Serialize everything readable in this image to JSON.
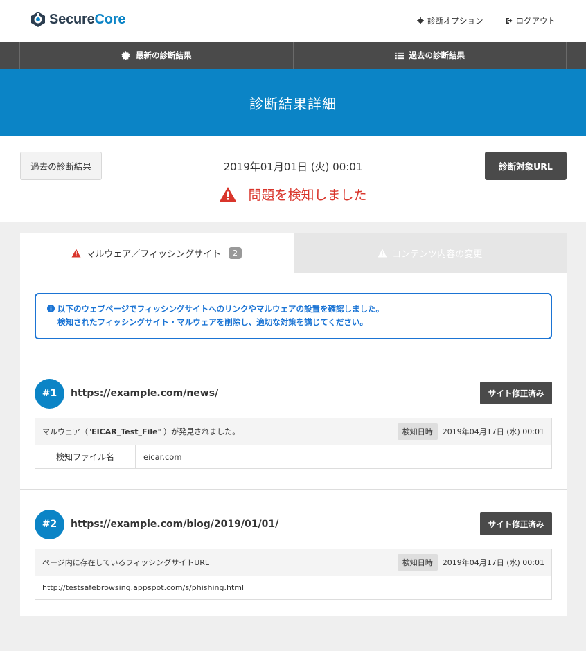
{
  "brand": {
    "name_part1": "Secure",
    "name_part2": "Core"
  },
  "top_links": {
    "options": "診断オプション",
    "logout": "ログアウト"
  },
  "nav": {
    "latest": "最新の診断結果",
    "history": "過去の診断結果"
  },
  "banner": {
    "title": "診断結果詳細"
  },
  "summary": {
    "past_button": "過去の診断結果",
    "date": "2019年01月01日 (火) 00:01",
    "alert": "問題を検知しました",
    "url_button": "診断対象URL"
  },
  "tabs": [
    {
      "label": "マルウェア／フィッシングサイト",
      "count": "2"
    },
    {
      "label": "コンテンツ内容の変更"
    }
  ],
  "info": {
    "line1": "以下のウェブページでフィッシングサイトへのリンクやマルウェアの設置を確認しました。",
    "line2": "検知されたフィッシングサイト・マルウェアを削除し、適切な対策を講じてください。"
  },
  "findings": [
    {
      "number": "#1",
      "url": "https://example.com/news/",
      "button": "サイト修正済み",
      "desc_prefix": "マルウェア（\"",
      "desc_bold": "EICAR_Test_File",
      "desc_suffix": "\" ）が発見されました。",
      "tag": "検知日時",
      "detected": "2019年04月17日 (水) 00:01",
      "row_key": "検知ファイル名",
      "row_value": "eicar.com"
    },
    {
      "number": "#2",
      "url": "https://example.com/blog/2019/01/01/",
      "button": "サイト修正済み",
      "desc": "ページ内に存在しているフィッシングサイトURL",
      "tag": "検知日時",
      "detected": "2019年04月17日 (水) 00:01",
      "row_value": "http://testsafebrowsing.appspot.com/s/phishing.html"
    }
  ],
  "colors": {
    "accent": "#0b84c6",
    "alert": "#d9352b",
    "info": "#1b74d4",
    "dark": "#4a4a4a"
  }
}
